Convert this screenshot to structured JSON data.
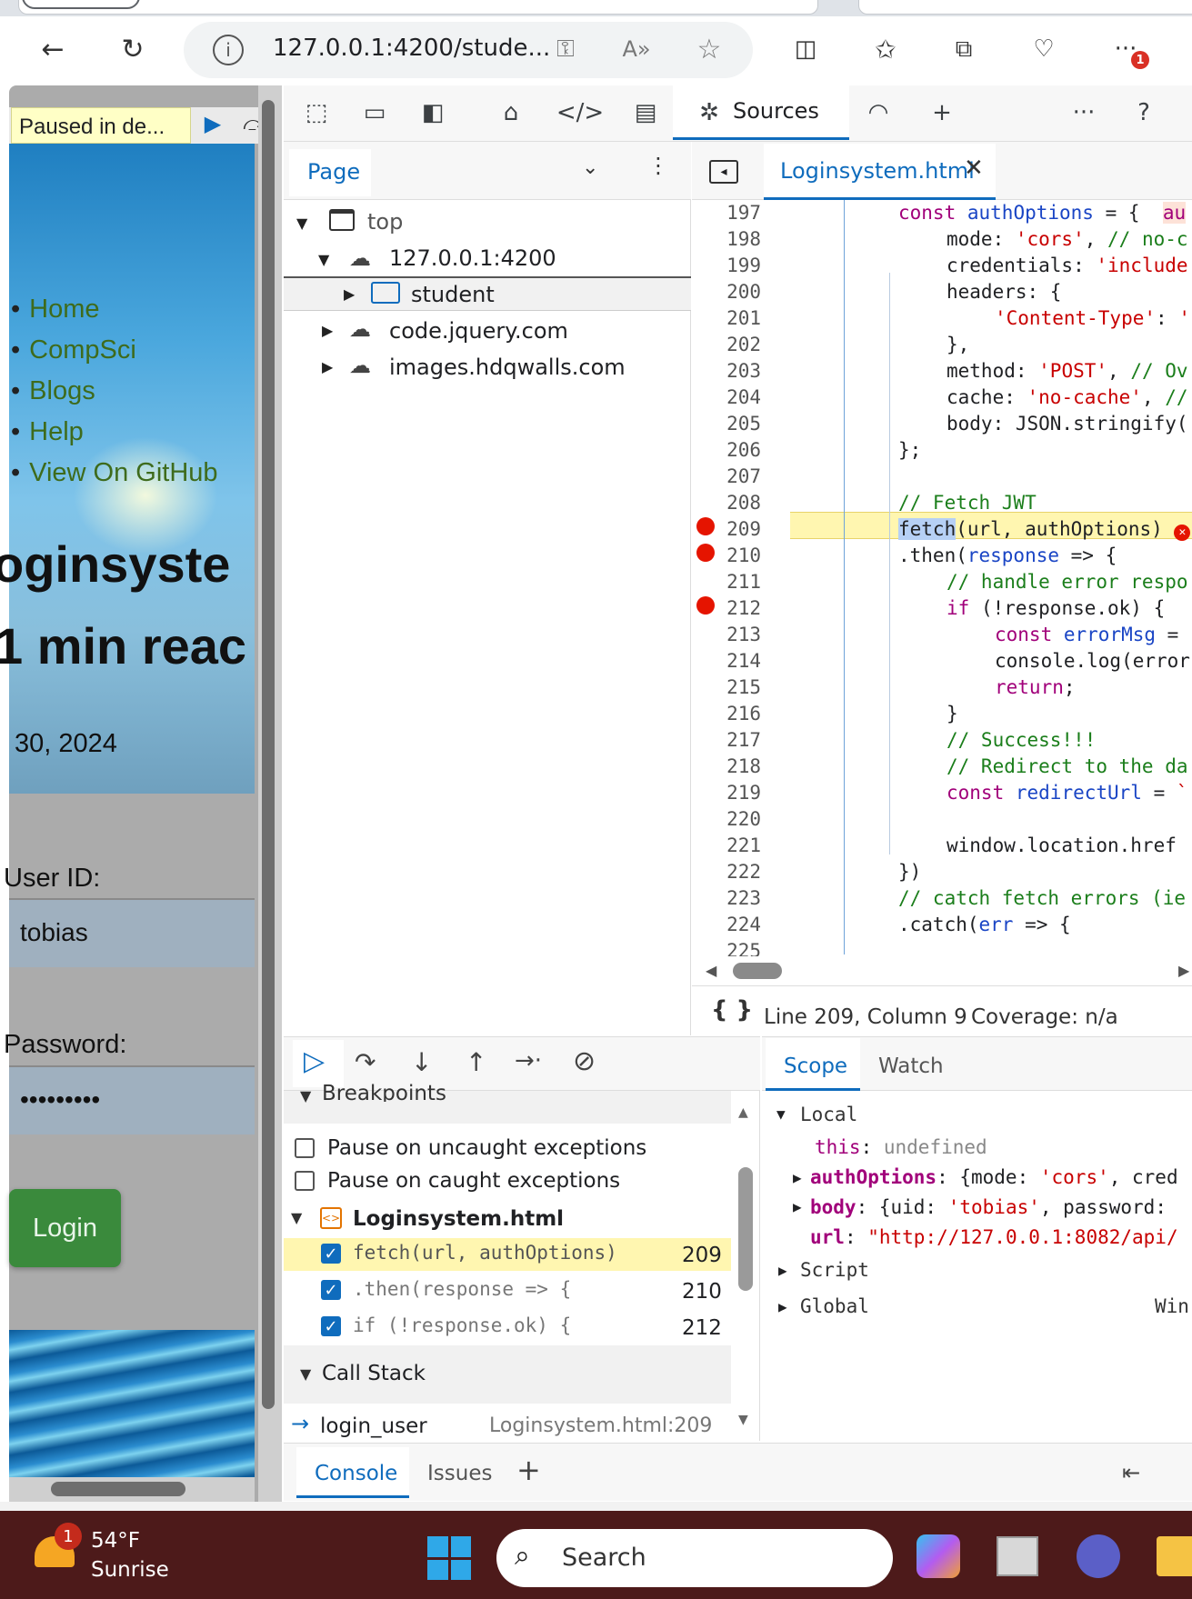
{
  "browser": {
    "url": "127.0.0.1:4200/stude...",
    "notification_count": "1"
  },
  "page": {
    "paused_label": "Paused in de...",
    "nav_links": [
      "Home",
      "CompSci",
      "Blogs",
      "Help",
      "View On GitHub"
    ],
    "title_fragment": "oginsyste",
    "read_time": "1 min reac",
    "date": "30, 2024",
    "user_id_label": "User ID:",
    "user_id_value": "tobias",
    "password_label": "Password:",
    "password_value": "•••••••••",
    "login_button": "Login"
  },
  "devtools": {
    "sources_tab": "Sources",
    "navigator": {
      "page_tab": "Page",
      "tree": [
        {
          "label": "top"
        },
        {
          "label": "127.0.0.1:4200"
        },
        {
          "label": "student"
        },
        {
          "label": "code.jquery.com"
        },
        {
          "label": "images.hdqwalls.com"
        }
      ]
    },
    "editor": {
      "file_tab": "Loginsystem.html",
      "status": "Line 209, Column 9",
      "coverage": "Coverage: n/a",
      "format_glyph": "{ }"
    },
    "debugger": {
      "breakpoints_header": "Breakpoints",
      "pause_uncaught": "Pause on uncaught exceptions",
      "pause_caught": "Pause on caught exceptions",
      "file": "Loginsystem.html",
      "breakpoints": [
        {
          "code": "fetch(url, authOptions)",
          "line": "209"
        },
        {
          "code": ".then(response => {",
          "line": "210"
        },
        {
          "code": "if (!response.ok) {",
          "line": "212"
        }
      ],
      "call_stack_header": "Call Stack",
      "call_stack": [
        {
          "fn": "login_user",
          "loc": "Loginsystem.html:209"
        }
      ]
    },
    "scope": {
      "tab_scope": "Scope",
      "tab_watch": "Watch",
      "local": "Local",
      "script": "Script",
      "global": "Global",
      "global_value": "Win"
    },
    "drawer": {
      "console": "Console",
      "issues": "Issues"
    }
  },
  "taskbar": {
    "weather_temp": "54°F",
    "weather_desc": "Sunrise",
    "weather_badge": "1",
    "search": "Search"
  }
}
